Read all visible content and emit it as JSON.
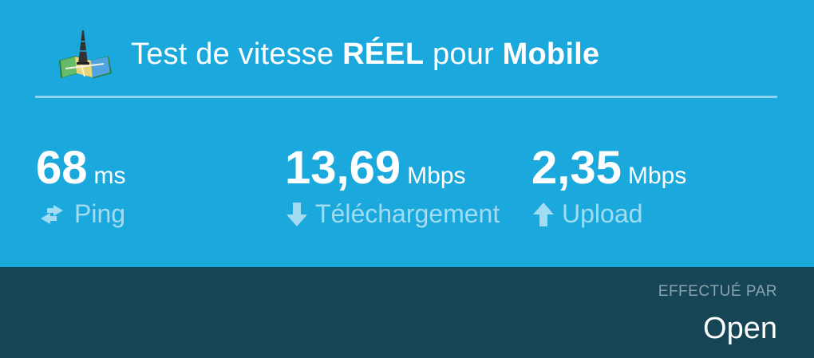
{
  "header": {
    "title_part1": "Test de vitesse ",
    "title_bold1": "RÉEL",
    "title_part2": " pour ",
    "title_bold2": "Mobile",
    "logo_icon": "map-tower-icon"
  },
  "metrics": {
    "ping": {
      "value": "68",
      "unit": "ms",
      "label": "Ping",
      "icon": "swap-arrows-icon"
    },
    "download": {
      "value": "13,69",
      "unit": "Mbps",
      "label": "Téléchargement",
      "icon": "arrow-down-icon"
    },
    "upload": {
      "value": "2,35",
      "unit": "Mbps",
      "label": "Upload",
      "icon": "arrow-up-icon"
    }
  },
  "footer": {
    "performed_by_label": "EFFECTUÉ PAR",
    "brand": "Open"
  },
  "colors": {
    "top_background": "#1ba8dc",
    "bottom_background": "#164556",
    "label_color": "#a2dcf3",
    "divider": "#8fd3ef"
  }
}
